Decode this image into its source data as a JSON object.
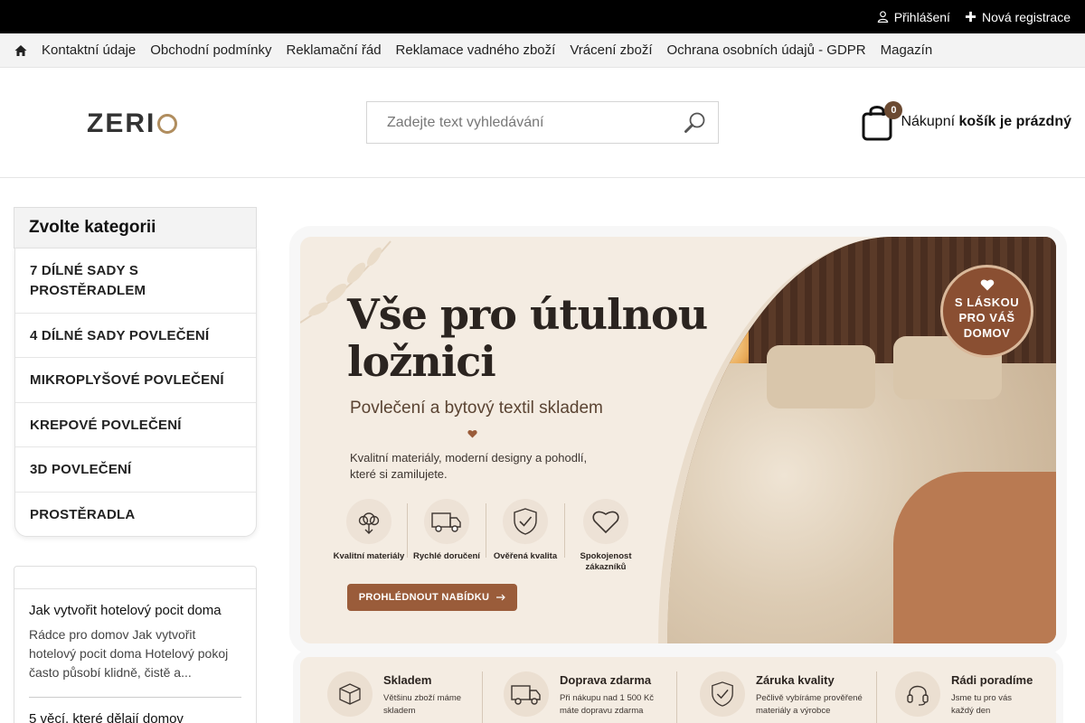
{
  "topbar": {
    "login": "Přihlášení",
    "register": "Nová registrace"
  },
  "nav": {
    "items": [
      "Kontaktní údaje",
      "Obchodní podmínky",
      "Reklamační řád",
      "Reklamace vadného zboží",
      "Vrácení zboží",
      "Ochrana osobních údajů - GDPR",
      "Magazín"
    ]
  },
  "header": {
    "logo": "ZERI",
    "search_placeholder": "Zadejte text vyhledávání",
    "cart_count": "0",
    "cart_text_regular": "Nákupní",
    "cart_text_bold": "košík je prázdný"
  },
  "sidebar": {
    "title": "Zvolte kategorii",
    "categories": [
      "7 DÍLNÉ SADY S PROSTĚRADLEM",
      "4 DÍLNÉ SADY POVLEČENÍ",
      "MIKROPLYŠOVÉ POVLEČENÍ",
      "KREPOVÉ POVLEČENÍ",
      "3D POVLEČENÍ",
      "PROSTĚRADLA"
    ]
  },
  "blog": {
    "items": [
      {
        "title": "Jak vytvořit hotelový pocit doma",
        "desc": "Rádce pro domov Jak vytvořit hotelový pocit doma Hotelový pokoj často působí klidně, čistě a..."
      },
      {
        "title": "5 věcí, které dělají domov",
        "desc": ""
      }
    ]
  },
  "banner": {
    "title": "Vše pro útulnou ložnici",
    "subtitle": "Povlečení a bytový textil skladem",
    "desc": "Kvalitní materiály, moderní designy a pohodlí, které si zamilujete.",
    "features": [
      {
        "label": "Kvalitní materiály",
        "icon": "cotton-icon"
      },
      {
        "label": "Rychlé doručení",
        "icon": "truck-icon"
      },
      {
        "label": "Ověřená kvalita",
        "icon": "shield-check-icon"
      },
      {
        "label": "Spokojenost zákazníků",
        "icon": "heart-icon"
      }
    ],
    "button": "PROHLÉDNOUT NABÍDKU",
    "stamp": "S LÁSKOU PRO VÁŠ DOMOV"
  },
  "strip": {
    "items": [
      {
        "title": "Skladem",
        "desc": "Většinu zboží máme skladem",
        "icon": "box-icon"
      },
      {
        "title": "Doprava zdarma",
        "desc": "Při nákupu nad 1 500 Kč máte dopravu zdarma",
        "icon": "truck-icon"
      },
      {
        "title": "Záruka kvality",
        "desc": "Pečlivě vybíráme prověřené materiály a výrobce",
        "icon": "shield-check-icon"
      },
      {
        "title": "Rádi poradíme",
        "desc": "Jsme tu pro vás každý den",
        "icon": "headset-icon"
      }
    ]
  },
  "colors": {
    "accent_brown": "#9a5c3a",
    "badge_brown": "#6b4a32",
    "banner_bg": "#f4ece2"
  }
}
